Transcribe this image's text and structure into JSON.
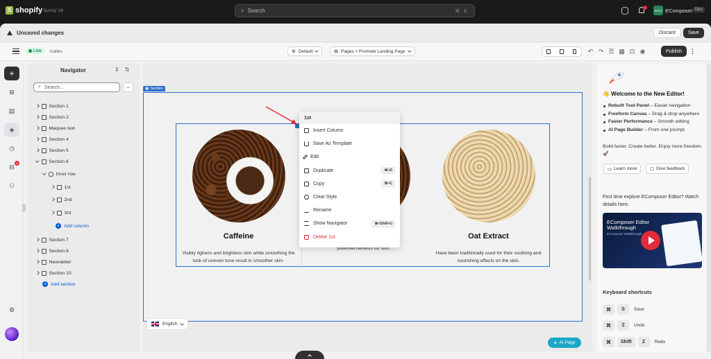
{
  "topbar": {
    "brand": "shopify",
    "edition": "Spring '26",
    "search_placeholder": "Search",
    "search_shortcut": "⌘ K",
    "store_initials": "ECO",
    "store_name": "EComposer",
    "store_badge": "Dev"
  },
  "unsaved": {
    "message": "Unsaved changes",
    "discard": "Discard",
    "save": "Save"
  },
  "toolbar": {
    "status": "Live",
    "theme": "Kalles",
    "template": "Default",
    "breadcrumb": "Pages > Promote Landing Page",
    "publish": "Publish"
  },
  "rail": {
    "notification_count": "3"
  },
  "navigator": {
    "title": "Navigator",
    "search_placeholder": "Search...",
    "items": [
      {
        "label": "Section 1"
      },
      {
        "label": "Section 2"
      },
      {
        "label": "Maquee text"
      },
      {
        "label": "Section 4"
      },
      {
        "label": "Section 5"
      },
      {
        "label": "Section 6"
      },
      {
        "label": "Inner row"
      },
      {
        "label": "1st"
      },
      {
        "label": "2nd"
      },
      {
        "label": "3rd"
      },
      {
        "label": "Add column"
      },
      {
        "label": "Section 7"
      },
      {
        "label": "Section 8"
      },
      {
        "label": "Newsletter"
      },
      {
        "label": "Section 10"
      },
      {
        "label": "Add section"
      }
    ]
  },
  "canvas": {
    "section_label": "Section",
    "columns": [
      {
        "title": "Caffeine",
        "desc": "Visibly tighens and brightens skin while smoothing the look of uneven tone result in smoother skin."
      },
      {
        "title": "",
        "desc": "potential benefits for skin."
      },
      {
        "title": "Oat Extract",
        "desc": "Have been traditionally used for their soothing and nourishing effects on the skin."
      }
    ],
    "language": "English",
    "ai_button": "AI Page"
  },
  "context_menu": {
    "title": "1st",
    "items": [
      {
        "label": "Insert Column",
        "shortcut": ""
      },
      {
        "label": "Save As Template",
        "shortcut": ""
      },
      {
        "label": "Edit",
        "shortcut": ""
      },
      {
        "label": "Duplicate",
        "shortcut": "⌘+D"
      },
      {
        "label": "Copy",
        "shortcut": "⌘+C"
      },
      {
        "label": "Clear Style",
        "shortcut": ""
      },
      {
        "label": "Rename",
        "shortcut": ""
      },
      {
        "label": "Show Navigator",
        "shortcut": "⌘+Shift+U"
      },
      {
        "label": "Delete 1st",
        "shortcut": ""
      }
    ]
  },
  "right_panel": {
    "welcome": "👋 Welcome to the New Editor!",
    "features": [
      {
        "bold": "Rebuilt Tool Panel",
        "rest": " – Easier navigation"
      },
      {
        "bold": "Freeform Canvas",
        "rest": " – Drag & drop anywhere"
      },
      {
        "bold": "Faster Performance",
        "rest": " – Smooth editing"
      },
      {
        "bold": "AI Page Builder",
        "rest": " – From one prompt"
      }
    ],
    "tagline": "Build faster. Create better. Enjoy more freedom. 🚀",
    "learn_more": "Learn more",
    "give_feedback": "Give feedback",
    "first_time": "First time explore EComposer Editor? Watch details here.",
    "video_title": "EComposer Editor Walkthrough",
    "video_sub": "EComposer Walkthrough",
    "shortcuts_title": "Keyboard shortcuts",
    "shortcuts": [
      {
        "keys": [
          "⌘",
          "S"
        ],
        "label": "Save"
      },
      {
        "keys": [
          "⌘",
          "Z"
        ],
        "label": "Undo"
      },
      {
        "keys": [
          "⌘",
          "Shift",
          "Z"
        ],
        "label": "Redo"
      }
    ]
  }
}
